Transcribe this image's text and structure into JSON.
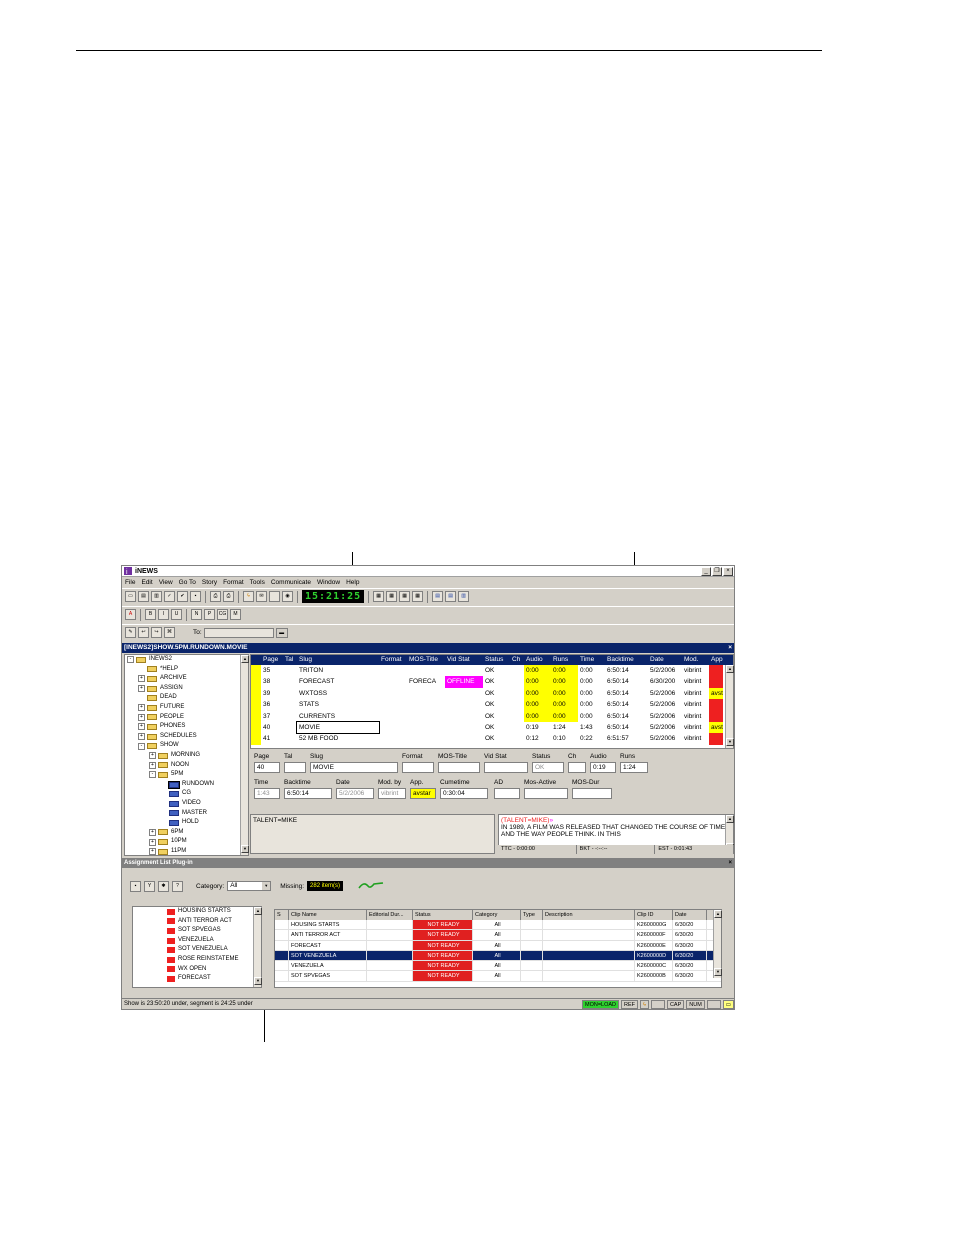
{
  "window": {
    "title": "iNEWS",
    "menus": [
      "File",
      "Edit",
      "View",
      "Go To",
      "Story",
      "Format",
      "Tools",
      "Communicate",
      "Window",
      "Help"
    ],
    "clock": "15:21:25",
    "to_label": "To:"
  },
  "path": "[INEWS2]SHOW.5PM.RUNDOWN.MOVIE",
  "tree": [
    {
      "label": "INEWS2",
      "level": 0,
      "exp": "-"
    },
    {
      "label": "*HELP",
      "level": 1,
      "exp": ""
    },
    {
      "label": "ARCHIVE",
      "level": 1,
      "exp": "+"
    },
    {
      "label": "ASSIGN",
      "level": 1,
      "exp": "+"
    },
    {
      "label": "DEAD",
      "level": 1,
      "exp": ""
    },
    {
      "label": "FUTURE",
      "level": 1,
      "exp": "+"
    },
    {
      "label": "PEOPLE",
      "level": 1,
      "exp": "+"
    },
    {
      "label": "PHONES",
      "level": 1,
      "exp": "+"
    },
    {
      "label": "SCHEDULES",
      "level": 1,
      "exp": "+"
    },
    {
      "label": "SHOW",
      "level": 1,
      "exp": "-"
    },
    {
      "label": "MORNING",
      "level": 2,
      "exp": "+"
    },
    {
      "label": "NOON",
      "level": 2,
      "exp": "+"
    },
    {
      "label": "5PM",
      "level": 2,
      "exp": "-"
    },
    {
      "label": "RUNDOWN",
      "level": 3,
      "exp": "",
      "q": true,
      "sel": true
    },
    {
      "label": "CG",
      "level": 3,
      "exp": "",
      "q": true
    },
    {
      "label": "VIDEO",
      "level": 3,
      "exp": "",
      "q": true
    },
    {
      "label": "MASTER",
      "level": 3,
      "exp": "",
      "q": true
    },
    {
      "label": "HOLD",
      "level": 3,
      "exp": "",
      "q": true
    },
    {
      "label": "6PM",
      "level": 2,
      "exp": "+"
    },
    {
      "label": "10PM",
      "level": 2,
      "exp": "+"
    },
    {
      "label": "11PM",
      "level": 2,
      "exp": "+"
    }
  ],
  "rundown": {
    "columns": [
      "Page",
      "Tal",
      "Slug",
      "Format",
      "MOS-Title",
      "Vid Stat",
      "Status",
      "Ch",
      "Audio",
      "Runs",
      "Time",
      "Backtime",
      "Date",
      "Mod.",
      "App"
    ],
    "rows": [
      [
        "35",
        "",
        "TRITON",
        "",
        "",
        "",
        "OK",
        "",
        "0:00",
        "0:00",
        "0:00",
        "6:50:14",
        "5/2/2006",
        "vibrint",
        ""
      ],
      [
        "38",
        "",
        "FORECAST",
        "",
        "FORECA",
        "OFFLINE",
        "OK",
        "",
        "0:00",
        "0:00",
        "0:00",
        "6:50:14",
        "6/30/200",
        "vibrint",
        ""
      ],
      [
        "39",
        "",
        "WXTOSS",
        "",
        "",
        "",
        "OK",
        "",
        "0:00",
        "0:00",
        "0:00",
        "6:50:14",
        "5/2/2006",
        "vibrint",
        "avst"
      ],
      [
        "36",
        "",
        "STATS",
        "",
        "",
        "",
        "OK",
        "",
        "0:00",
        "0:00",
        "0:00",
        "6:50:14",
        "5/2/2006",
        "vibrint",
        ""
      ],
      [
        "37",
        "",
        "CURRENTS",
        "",
        "",
        "",
        "OK",
        "",
        "0:00",
        "0:00",
        "0:00",
        "6:50:14",
        "5/2/2006",
        "vibrint",
        ""
      ],
      [
        "40",
        "",
        "MOVIE",
        "",
        "",
        "",
        "OK",
        "",
        "0:19",
        "1:24",
        "1:43",
        "6:50:14",
        "5/2/2006",
        "vibrint",
        "avst"
      ],
      [
        "41",
        "",
        "52 MB FOOD",
        "",
        "",
        "",
        "OK",
        "",
        "0:12",
        "0:10",
        "0:22",
        "6:51:57",
        "5/2/2006",
        "vibrint",
        ""
      ]
    ]
  },
  "form": {
    "row1_labels": [
      "Page",
      "Tal",
      "Slug",
      "Format",
      "MOS-Title",
      "Vid Stat",
      "Status",
      "Ch",
      "Audio",
      "Runs"
    ],
    "row1_values": [
      "40",
      "",
      "MOVIE",
      "",
      "",
      "",
      "OK",
      "",
      "0:19",
      "1:24"
    ],
    "row2_labels": [
      "Time",
      "Backtime",
      "Date",
      "Mod. by",
      "App.",
      "Cumetime",
      "AD",
      "Mos-Active",
      "MOS-Dur"
    ],
    "row2_values": [
      "1:43",
      "6:50:14",
      "5/2/2006",
      "vibrint",
      "avstar",
      "0:30:04",
      "",
      "",
      ""
    ]
  },
  "instruction": "TALENT=MIKE",
  "script": {
    "talent": "(TALENT=MIKE)",
    "marker": "»",
    "body": "IN 1989, A FILM WAS RELEASED THAT CHANGED THE COURSE OF TIME AND THE WAY PEOPLE THINK. IN THIS",
    "ttc": "TTC - 0:00:00",
    "bkt": "BKT - -:--:--",
    "est": "EST - 0:01:43"
  },
  "plugin": {
    "title": "Assignment List Plug-in",
    "category_label": "Category:",
    "category_value": "All",
    "missing_label": "Missing:",
    "missing_value": "282 item(s)"
  },
  "assign_tree": [
    "HOUSING STARTS",
    "ANTI TERROR ACT",
    "SOT SPVEGAS",
    "VENEZUELA",
    "SOT VENEZUELA",
    "ROSE REINSTATEME",
    "WX OPEN",
    "FORECAST"
  ],
  "clips": {
    "columns": [
      "S",
      "Clip Name",
      "Editorial Dur...",
      "Status",
      "Category",
      "Type",
      "Description",
      "Clip ID",
      "Date"
    ],
    "rows": [
      [
        "",
        "HOUSING STARTS",
        "",
        "NOT READY",
        "All",
        "",
        "",
        "K2600000G",
        "6/30/20"
      ],
      [
        "",
        "ANTI TERROR ACT",
        "",
        "NOT READY",
        "All",
        "",
        "",
        "K2600000F",
        "6/30/20"
      ],
      [
        "",
        "FORECAST",
        "",
        "NOT READY",
        "All",
        "",
        "",
        "K2600000E",
        "6/30/20"
      ],
      [
        "",
        "SOT VENEZUELA",
        "",
        "NOT READY",
        "All",
        "",
        "",
        "K2600000D",
        "6/30/20"
      ],
      [
        "",
        "VENEZUELA",
        "",
        "NOT READY",
        "All",
        "",
        "",
        "K2600000C",
        "6/30/20"
      ],
      [
        "",
        "SOT SPVEGAS",
        "",
        "NOT READY",
        "All",
        "",
        "",
        "K2600000B",
        "6/30/20"
      ]
    ]
  },
  "statusbar": {
    "text": "Show is 23:50:20 under, segment is 24:25 under",
    "mon": "MON=LOAD",
    "ref": "REF",
    "cap": "CAP",
    "num": "NUM"
  }
}
